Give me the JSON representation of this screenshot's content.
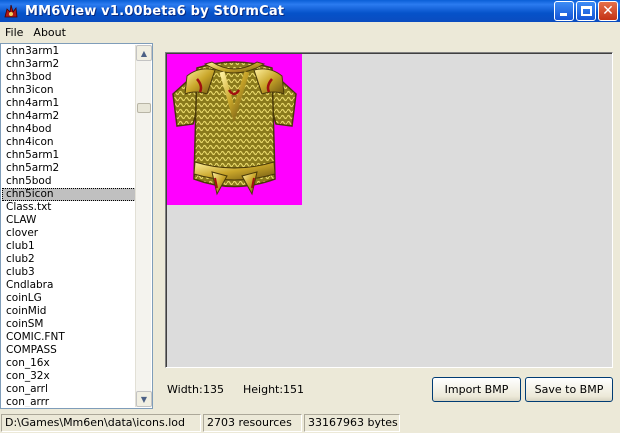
{
  "window": {
    "title": "MM6View v1.00beta6 by St0rmCat"
  },
  "menu": {
    "items": [
      "File",
      "About"
    ]
  },
  "file_list": {
    "items": [
      "chn3arm1",
      "chn3arm2",
      "chn3bod",
      "chn3icon",
      "chn4arm1",
      "chn4arm2",
      "chn4bod",
      "chn4icon",
      "chn5arm1",
      "chn5arm2",
      "chn5bod",
      "chn5icon",
      "Class.txt",
      "CLAW",
      "clover",
      "club1",
      "club2",
      "club3",
      "Cndlabra",
      "coinLG",
      "coinMid",
      "coinSM",
      "COMIC.FNT",
      "COMPASS",
      "con_16x",
      "con_32x",
      "con_arrl",
      "con_arrr"
    ],
    "selected": "chn5icon",
    "scroll_position": 0.13
  },
  "viewer": {
    "background_color": "#ff00ff",
    "width_label": "Width:",
    "width_value": "135",
    "height_label": "Height:",
    "height_value": "151"
  },
  "buttons": {
    "import": "Import BMP",
    "save": "Save to BMP"
  },
  "status": {
    "path": "D:\\Games\\Mm6en\\data\\icons.lod",
    "resources": "2703 resources",
    "bytes": "33167963 bytes"
  },
  "icons": [
    "app-icon",
    "minimize-icon",
    "maximize-icon",
    "close-icon",
    "scroll-up-arrow-icon",
    "scroll-down-arrow-icon",
    "chainmail-armor-image"
  ]
}
